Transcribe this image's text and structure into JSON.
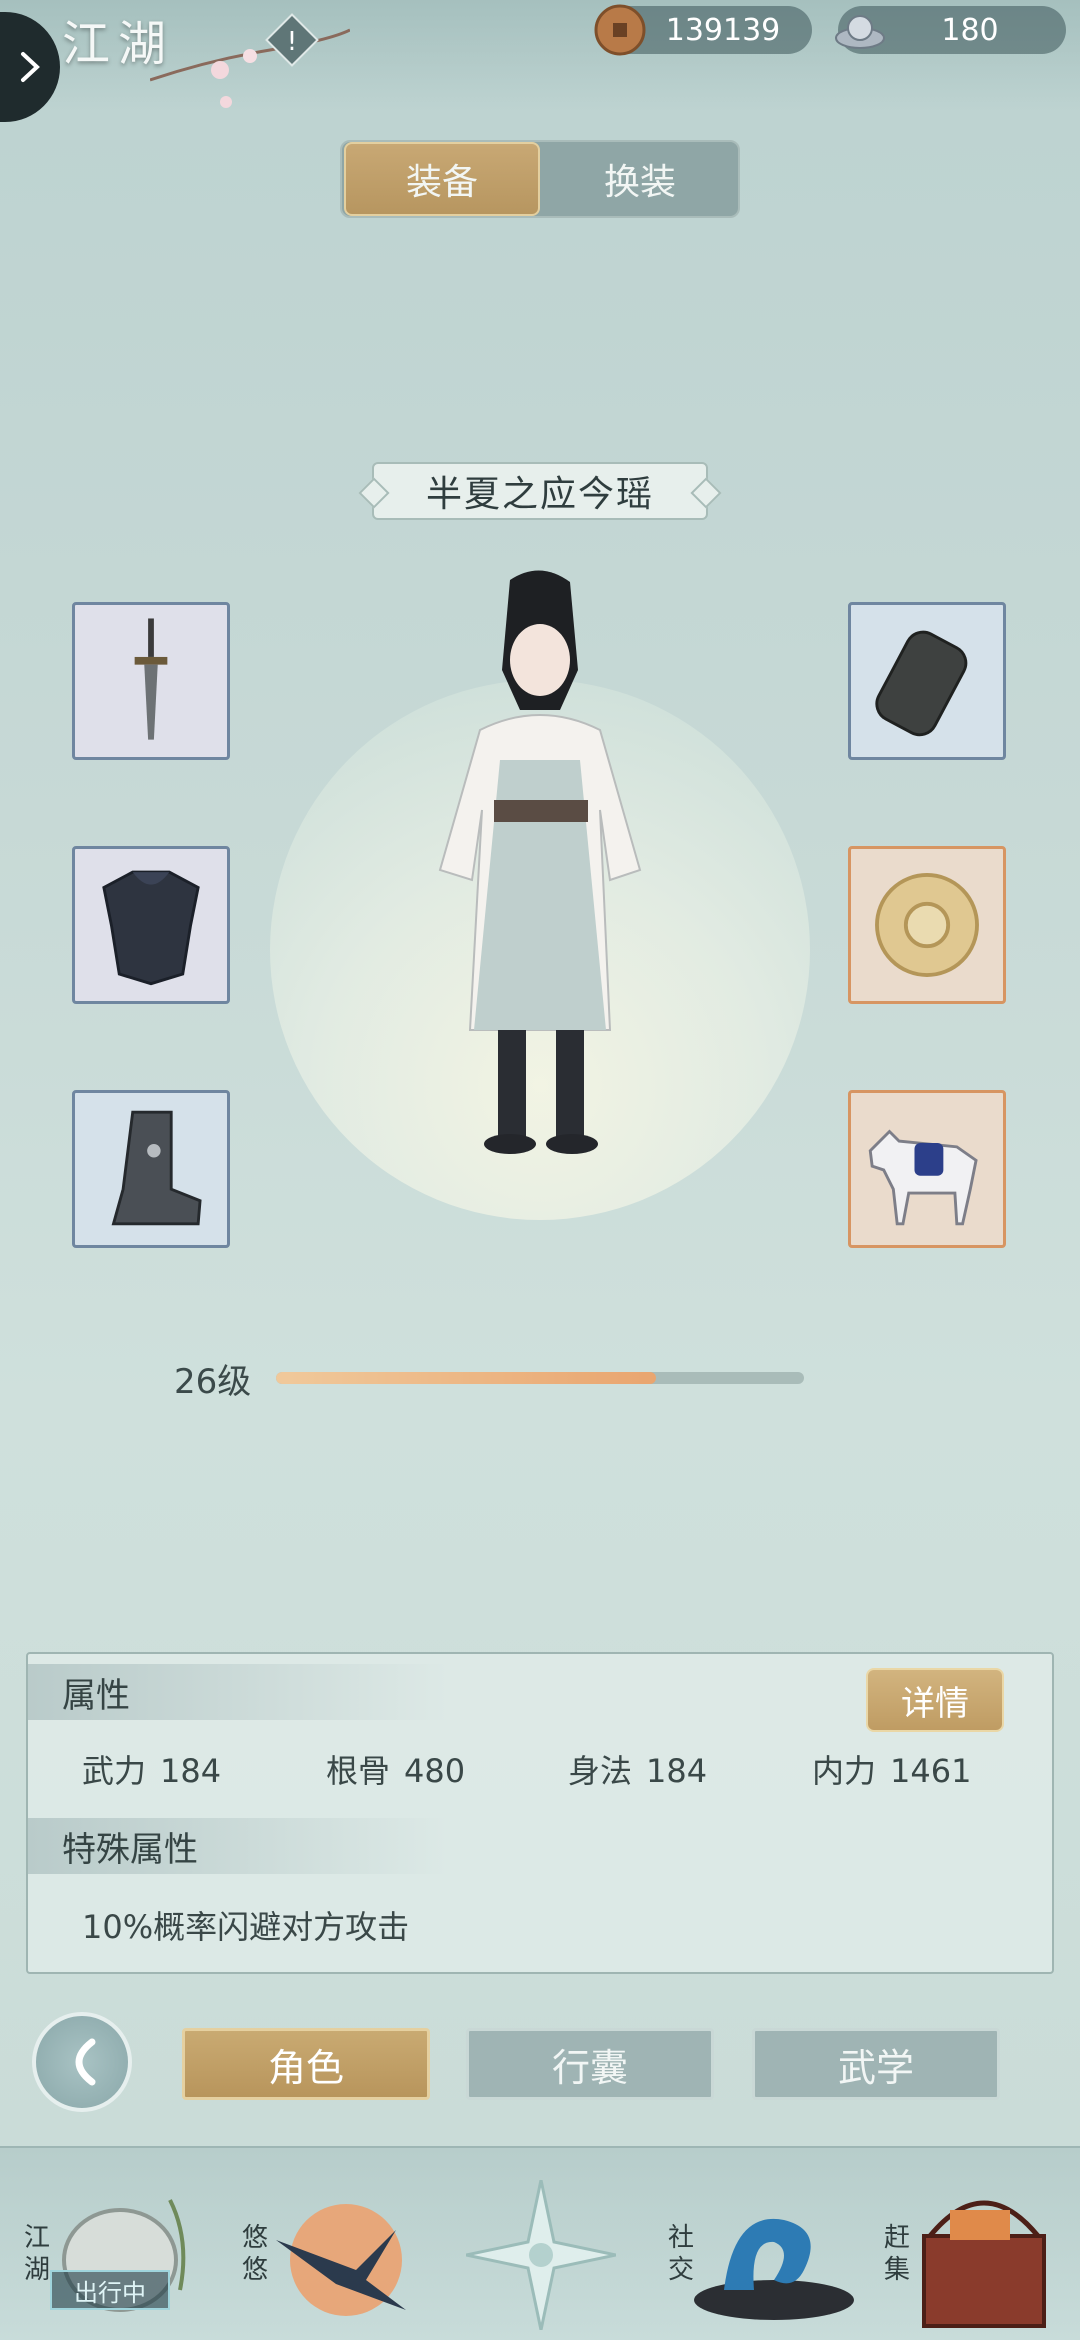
{
  "topbar": {
    "scene_title": "江湖",
    "copper": "139139",
    "silver": "180"
  },
  "tabs": {
    "equip": "装备",
    "outfit": "换装"
  },
  "character": {
    "name": "半夏之应今瑶",
    "level_text": "26级",
    "xp_progress": 0.72
  },
  "equipment": {
    "left": [
      "weapon-dagger-icon",
      "armor-chestplate-icon",
      "boots-icon"
    ],
    "right": [
      "bracer-icon",
      "jade-pendant-icon",
      "horse-mount-icon"
    ]
  },
  "attributes": {
    "title": "属性",
    "detail_label": "详情",
    "stats": [
      {
        "label": "武力",
        "value": "184"
      },
      {
        "label": "根骨",
        "value": "480"
      },
      {
        "label": "身法",
        "value": "184"
      },
      {
        "label": "内力",
        "value": "1461"
      }
    ],
    "special_title": "特殊属性",
    "special_text": "10%概率闪避对方攻击"
  },
  "nav": {
    "role": "角色",
    "bag": "行囊",
    "martial": "武学"
  },
  "dock": {
    "jianghu": "江湖",
    "jianghu_status": "出行中",
    "youyou": "悠悠",
    "social": "社交",
    "market": "赶集"
  },
  "colors": {
    "gold": "#c4a36b",
    "teal": "#9fb4b4",
    "xp": "#e9a56f"
  }
}
